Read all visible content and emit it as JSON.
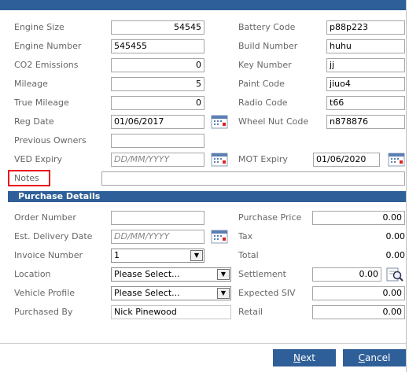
{
  "fields": {
    "engine_size": {
      "label": "Engine Size",
      "value": "54545"
    },
    "engine_number": {
      "label": "Engine Number",
      "value": "545455"
    },
    "co2": {
      "label": "CO2 Emissions",
      "value": "0"
    },
    "mileage": {
      "label": "Mileage",
      "value": "5"
    },
    "true_mileage": {
      "label": "True Mileage",
      "value": "0"
    },
    "reg_date": {
      "label": "Reg Date",
      "value": "01/06/2017"
    },
    "previous_owners": {
      "label": "Previous Owners",
      "value": ""
    },
    "ved_expiry": {
      "label": "VED Expiry",
      "placeholder": "DD/MM/YYYY"
    },
    "notes": {
      "label": "Notes",
      "value": ""
    },
    "battery_code": {
      "label": "Battery Code",
      "value": "p88p223"
    },
    "build_number": {
      "label": "Build Number",
      "value": "huhu"
    },
    "key_number": {
      "label": "Key Number",
      "value": "jj"
    },
    "paint_code": {
      "label": "Paint Code",
      "value": "jiuo4"
    },
    "radio_code": {
      "label": "Radio Code",
      "value": "t66"
    },
    "wheel_nut_code": {
      "label": "Wheel Nut Code",
      "value": "n878876"
    },
    "mot_expiry": {
      "label": "MOT Expiry",
      "value": "01/06/2020"
    }
  },
  "purchase": {
    "section_title": "Purchase Details",
    "order_number": {
      "label": "Order Number",
      "value": ""
    },
    "est_delivery": {
      "label": "Est. Delivery Date",
      "placeholder": "DD/MM/YYYY"
    },
    "invoice_number": {
      "label": "Invoice Number",
      "value": "1"
    },
    "location": {
      "label": "Location",
      "value": "Please Select..."
    },
    "vehicle_profile": {
      "label": "Vehicle Profile",
      "value": "Please Select..."
    },
    "purchased_by": {
      "label": "Purchased By",
      "value": "Nick Pinewood"
    },
    "purchase_price": {
      "label": "Purchase Price",
      "value": "0.00"
    },
    "tax": {
      "label": "Tax",
      "value": "0.00"
    },
    "total": {
      "label": "Total",
      "value": "0.00"
    },
    "settlement": {
      "label": "Settlement",
      "value": "0.00"
    },
    "expected_siv": {
      "label": "Expected SIV",
      "value": "0.00"
    },
    "retail": {
      "label": "Retail",
      "value": "0.00"
    }
  },
  "buttons": {
    "next_prefix": "",
    "next_u": "N",
    "next_rest": "ext",
    "cancel_u": "C",
    "cancel_rest": "ancel"
  },
  "colors": {
    "header": "#2f5f98",
    "highlight": "#e8101d"
  }
}
